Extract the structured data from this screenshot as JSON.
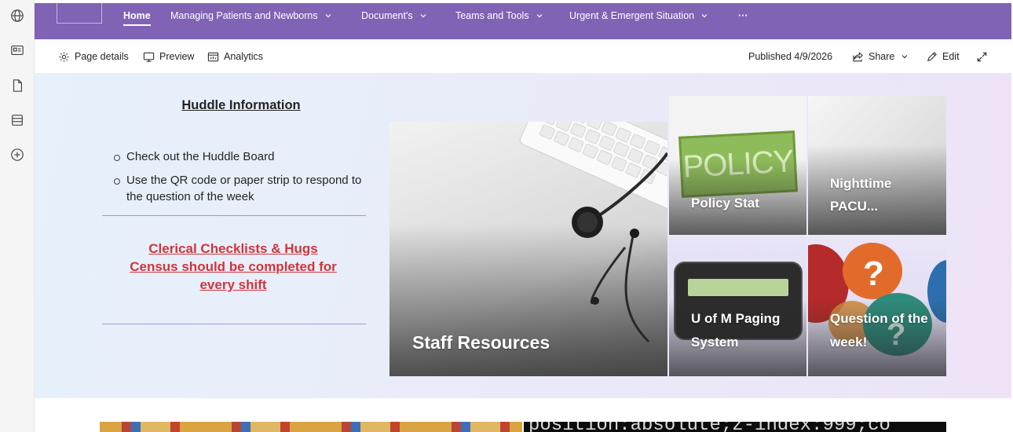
{
  "nav": {
    "items": [
      {
        "label": "Home",
        "active": true
      },
      {
        "label": "Managing Patients and Newborns"
      },
      {
        "label": "Document's"
      },
      {
        "label": "Teams and Tools"
      },
      {
        "label": "Urgent & Emergent Situation"
      },
      {
        "label": "···"
      }
    ]
  },
  "commandbar": {
    "page_details": "Page details",
    "preview": "Preview",
    "analytics": "Analytics",
    "published": "Published 4/9/2026",
    "share": "Share",
    "edit": "Edit"
  },
  "huddle": {
    "title": " Huddle Information",
    "bullets": [
      "Check out the Huddle Board",
      "Use the QR code or paper strip to respond to the question of the week"
    ],
    "red_line1": "Clerical Checklists & Hugs",
    "red_line2": "Census should be completed for every shift"
  },
  "tiles": {
    "staff": "Staff Resources",
    "policy": "Policy Stat",
    "policy_sign": "POLICY",
    "nighttime": "Nighttime PACU...",
    "paging": "U of M Paging System",
    "question": "Question of the week!"
  },
  "bottom_strip_code": "position:absolute;z-index:999;co",
  "colors": {
    "nav_bg": "#8063b4",
    "accent_red": "#d1343b",
    "divider": "#a597d3"
  },
  "icons": [
    "globe-icon",
    "news-icon",
    "page-icon",
    "list-icon",
    "add-icon",
    "gear-icon",
    "preview-icon",
    "analytics-icon",
    "share-icon",
    "edit-icon",
    "expand-icon",
    "chevron-down-icon"
  ]
}
